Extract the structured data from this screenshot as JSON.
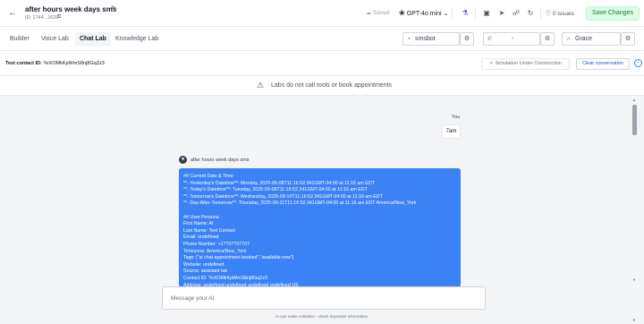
{
  "header": {
    "back_icon": "arrow-left-icon",
    "title": "after hours week days sms",
    "agent_id": "ID: 1744...1620",
    "saved_label": "Saved",
    "model_label": "GPT-4o mini",
    "issues_label": "0 issues",
    "save_label": "Save Changes"
  },
  "tabs": [
    {
      "label": "Builder"
    },
    {
      "label": "Voice Lab"
    },
    {
      "label": "Chat Lab",
      "active": true
    },
    {
      "label": "Knowledge Lab"
    }
  ],
  "selectors": {
    "channel": "smsbot",
    "phone": "-",
    "voice": "Grace"
  },
  "contact": {
    "label": "Test contact ID:",
    "id": "YeXOMkKpWmS8nj8GqZz3",
    "simulation_label": "Simulation Under Construction",
    "clear_label": "Clear conversation"
  },
  "banner": {
    "text": "Labs do not call tools or book appointments"
  },
  "chat": {
    "user_label": "You",
    "user_message": "7am",
    "ai_name": "after hours week days sms",
    "ai_lines": [
      "## Current Date & Time",
      "**- Yesterday's Datetime**: Monday, 2025-09-08T11:16:52.341GMT-04:00 at 11:16 am EDT",
      "**- Today's Datetime**: Tuesday, 2025-09-09T11:16:52.341GMT-04:00 at 11:16 am EDT",
      "**- Tomorrow's Datetime**: Wednesday, 2025-09-10T11:16:52.341GMT-04:00 at 11:16 am EDT",
      "**- Day-After-Tomorrow**: Thursday, 2025-09-11T11:16:52.341GMT-04:00 at 11:16 am EDT America/New_York",
      "",
      "## User Persona",
      "First Name: AI",
      "Last Name: Test Contact",
      "Email: undefined",
      "Phone Number: +17707707707",
      "Timezone: America/New_York",
      "Tags: [\"ai chat appointment booked\",\"available now\"]",
      "Website: undefined",
      "Source: assistant lab",
      "Contact ID: YeXOMkKpWmS8nj8GqZz3",
      "Address: undefined undefined undefined undefined US"
    ],
    "input_placeholder": "Message your AI",
    "disclaimer": "AI can make mistakes - check important information."
  },
  "colors": {
    "accent_purple": "#7c3aed",
    "ai_bubble": "#3b82f6",
    "save_green_bg": "#dcfce7",
    "save_green_text": "#15803d"
  }
}
